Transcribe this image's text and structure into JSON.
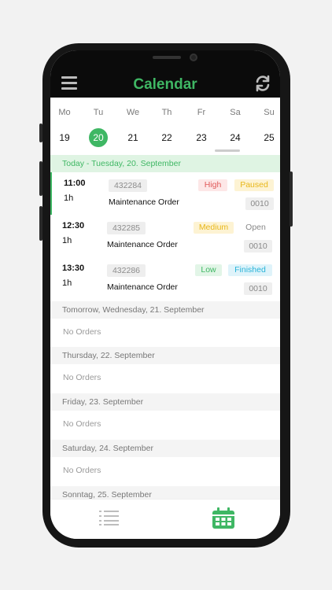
{
  "header": {
    "title": "Calendar"
  },
  "week": {
    "days": [
      {
        "name": "Mo",
        "num": "19"
      },
      {
        "name": "Tu",
        "num": "20"
      },
      {
        "name": "We",
        "num": "21"
      },
      {
        "name": "Th",
        "num": "22"
      },
      {
        "name": "Fr",
        "num": "23"
      },
      {
        "name": "Sa",
        "num": "24"
      },
      {
        "name": "Su",
        "num": "25"
      }
    ],
    "selected_day": "20"
  },
  "today": {
    "label": "Today - Tuesday, 20. September",
    "orders": [
      {
        "time": "11:00",
        "duration": "1h",
        "id": "432284",
        "title": "Maintenance Order",
        "priority": "High",
        "status": "Paused",
        "code": "0010"
      },
      {
        "time": "12:30",
        "duration": "1h",
        "id": "432285",
        "title": "Maintenance Order",
        "priority": "Medium",
        "status": "Open",
        "code": "0010"
      },
      {
        "time": "13:30",
        "duration": "1h",
        "id": "432286",
        "title": "Maintenance Order",
        "priority": "Low",
        "status": "Finished",
        "code": "0010"
      }
    ]
  },
  "upcoming": [
    {
      "label": "Tomorrow, Wednesday, 21. September",
      "empty": "No Orders"
    },
    {
      "label": "Thursday, 22. September",
      "empty": "No Orders"
    },
    {
      "label": "Friday, 23. September",
      "empty": "No Orders"
    },
    {
      "label": "Saturday, 24. September",
      "empty": "No Orders"
    },
    {
      "label": "Sonntag, 25. September",
      "empty": ""
    }
  ],
  "colors": {
    "accent": "#3fb764",
    "priority_high": "#e05a5a",
    "priority_medium": "#e8b71a",
    "priority_low": "#3fb764",
    "status_paused": "#e8b71a",
    "status_finished": "#27b3d8"
  },
  "icons": {
    "menu": "hamburger-icon",
    "refresh": "refresh-icon",
    "list": "list-icon",
    "calendar": "calendar-icon"
  }
}
